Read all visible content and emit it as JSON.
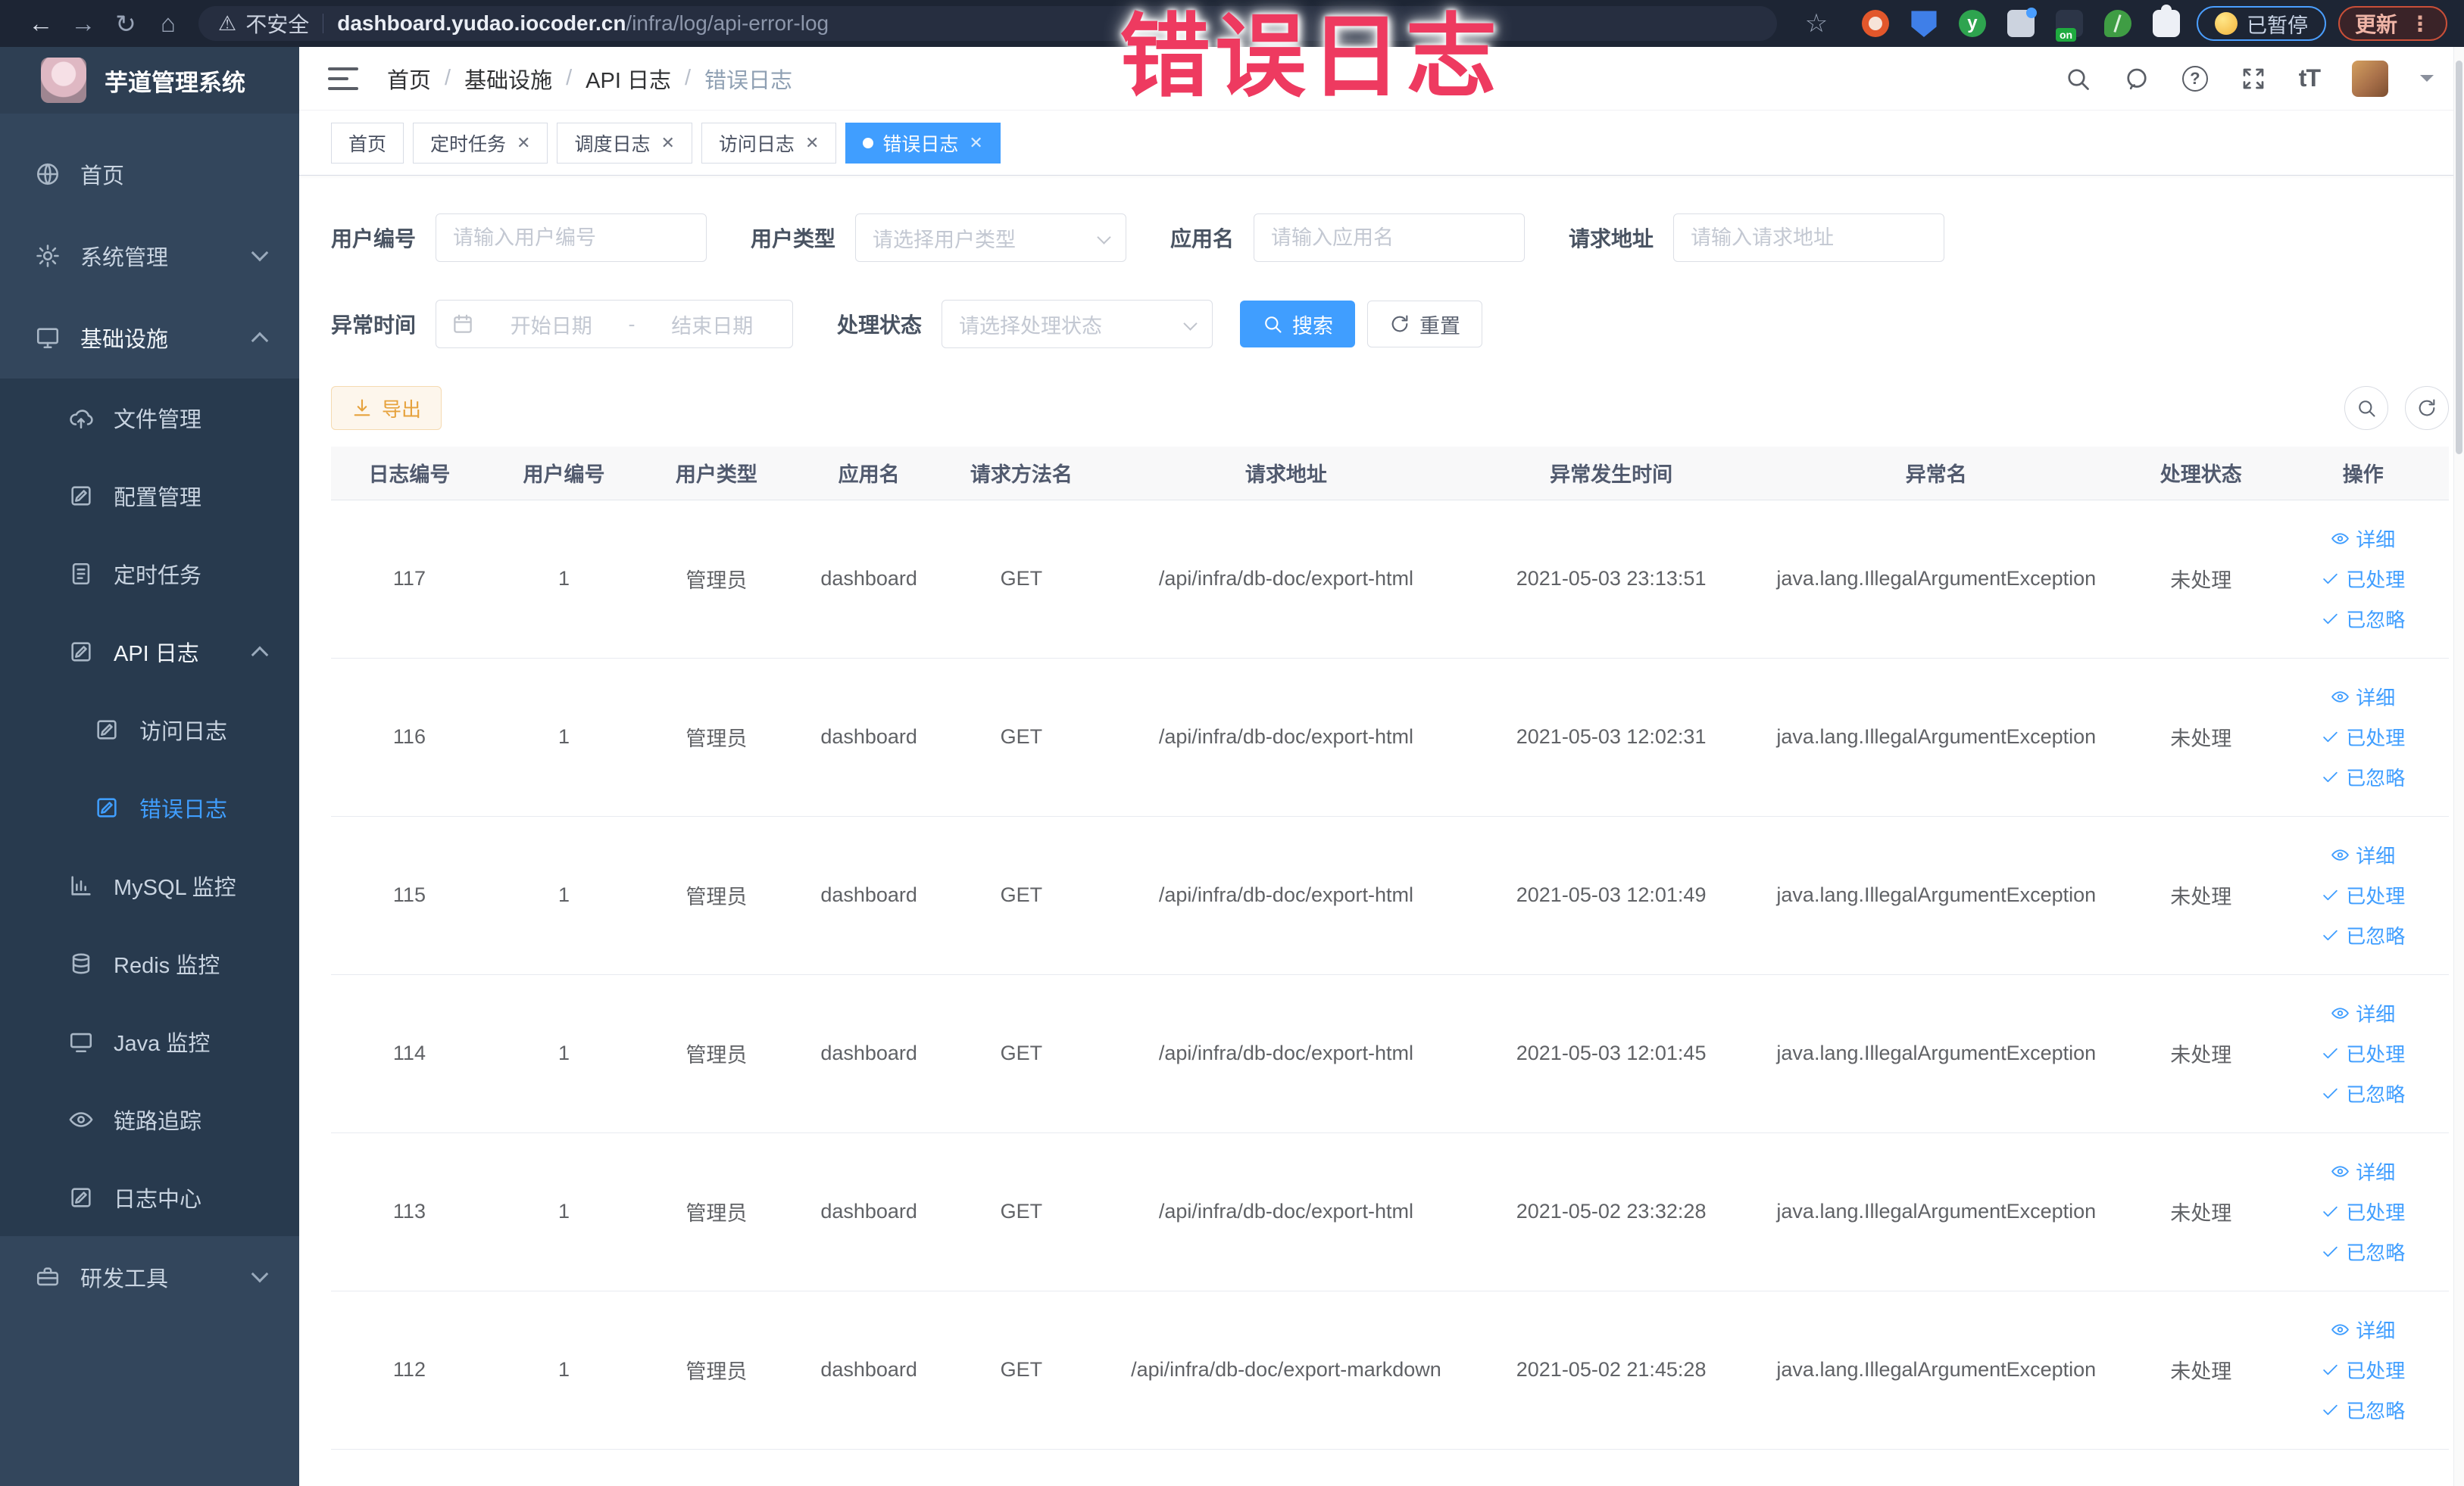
{
  "colors": {
    "accent": "#409eff",
    "warning": "#e6a23c",
    "overlay_red": "#ee3a60",
    "sidebar_bg": "#33465c",
    "sidebar_sub_bg": "#283a4e",
    "browser_bar_bg": "#1d2534",
    "tab_active_bg": "#409eff"
  },
  "browser": {
    "icons": {
      "back": "←",
      "forward": "→",
      "reload": "↻",
      "home": "⌂",
      "star": "☆",
      "warning": "⚠",
      "kebab": "⋮"
    },
    "security_label": "不安全",
    "url_host": "dashboard.yudao.iocoder.cn",
    "url_path": "/infra/log/api-error-log",
    "paused_label": "已暂停",
    "update_label": "更新"
  },
  "overlay": {
    "text": "错误日志"
  },
  "sidebar": {
    "logo_title": "芋道管理系统",
    "items": [
      {
        "key": "home",
        "label": "首页",
        "icon": "globe",
        "level": 1
      },
      {
        "key": "system-management",
        "label": "系统管理",
        "icon": "gear",
        "level": 1,
        "chevron": "down"
      },
      {
        "key": "infrastructure",
        "label": "基础设施",
        "icon": "monitor",
        "level": 1,
        "chevron": "up",
        "bright": true
      },
      {
        "key": "file-management",
        "label": "文件管理",
        "icon": "cloud-up",
        "level": 2,
        "submenu": true
      },
      {
        "key": "config-management",
        "label": "配置管理",
        "icon": "edit",
        "level": 2,
        "submenu": true
      },
      {
        "key": "scheduled-tasks",
        "label": "定时任务",
        "icon": "doc",
        "level": 2,
        "submenu": true
      },
      {
        "key": "api-log",
        "label": "API 日志",
        "icon": "edit",
        "level": 2,
        "chevron": "up",
        "submenu": true,
        "bright": true
      },
      {
        "key": "access-log",
        "label": "访问日志",
        "icon": "edit",
        "level": 3,
        "submenu": true
      },
      {
        "key": "error-log",
        "label": "错误日志",
        "icon": "edit",
        "level": 3,
        "submenu": true,
        "active": true
      },
      {
        "key": "mysql-monitor",
        "label": "MySQL 监控",
        "icon": "chart",
        "level": 2,
        "submenu": true
      },
      {
        "key": "redis-monitor",
        "label": "Redis 监控",
        "icon": "db",
        "level": 2,
        "submenu": true
      },
      {
        "key": "java-monitor",
        "label": "Java 监控",
        "icon": "screen",
        "level": 2,
        "submenu": true
      },
      {
        "key": "trace",
        "label": "链路追踪",
        "icon": "eye",
        "level": 2,
        "submenu": true
      },
      {
        "key": "log-center",
        "label": "日志中心",
        "icon": "edit",
        "level": 2,
        "submenu": true
      },
      {
        "key": "dev-tools",
        "label": "研发工具",
        "icon": "tool",
        "level": 1,
        "chevron": "down"
      }
    ]
  },
  "header": {
    "breadcrumb": [
      "首页",
      "基础设施",
      "API 日志",
      "错误日志"
    ],
    "icons": {
      "font_size": "tT"
    }
  },
  "tabs": [
    {
      "key": "home",
      "label": "首页",
      "closable": false,
      "active": false
    },
    {
      "key": "scheduled-tasks",
      "label": "定时任务",
      "closable": true,
      "active": false
    },
    {
      "key": "schedule-log",
      "label": "调度日志",
      "closable": true,
      "active": false
    },
    {
      "key": "access-log",
      "label": "访问日志",
      "closable": true,
      "active": false
    },
    {
      "key": "error-log",
      "label": "错误日志",
      "closable": true,
      "active": true
    }
  ],
  "filters": {
    "user_id_label": "用户编号",
    "user_id_placeholder": "请输入用户编号",
    "user_type_label": "用户类型",
    "user_type_placeholder": "请选择用户类型",
    "app_label": "应用名",
    "app_placeholder": "请输入应用名",
    "url_label": "请求地址",
    "url_placeholder": "请输入请求地址",
    "time_label": "异常时间",
    "time_start_placeholder": "开始日期",
    "time_separator": "-",
    "time_end_placeholder": "结束日期",
    "status_label": "处理状态",
    "status_placeholder": "请选择处理状态",
    "search_label": "搜索",
    "reset_label": "重置"
  },
  "toolbar": {
    "export_label": "导出"
  },
  "table": {
    "columns": [
      "日志编号",
      "用户编号",
      "用户类型",
      "应用名",
      "请求方法名",
      "请求地址",
      "异常发生时间",
      "异常名",
      "处理状态",
      "操作"
    ],
    "actions": [
      "详细",
      "已处理",
      "已忽略"
    ],
    "rows": [
      {
        "id": "117",
        "user_id": "1",
        "user_type": "管理员",
        "app": "dashboard",
        "method": "GET",
        "url": "/api/infra/db-doc/export-html",
        "time": "2021-05-03 23:13:51",
        "exception": "java.lang.IllegalArgumentException",
        "status": "未处理"
      },
      {
        "id": "116",
        "user_id": "1",
        "user_type": "管理员",
        "app": "dashboard",
        "method": "GET",
        "url": "/api/infra/db-doc/export-html",
        "time": "2021-05-03 12:02:31",
        "exception": "java.lang.IllegalArgumentException",
        "status": "未处理"
      },
      {
        "id": "115",
        "user_id": "1",
        "user_type": "管理员",
        "app": "dashboard",
        "method": "GET",
        "url": "/api/infra/db-doc/export-html",
        "time": "2021-05-03 12:01:49",
        "exception": "java.lang.IllegalArgumentException",
        "status": "未处理"
      },
      {
        "id": "114",
        "user_id": "1",
        "user_type": "管理员",
        "app": "dashboard",
        "method": "GET",
        "url": "/api/infra/db-doc/export-html",
        "time": "2021-05-03 12:01:45",
        "exception": "java.lang.IllegalArgumentException",
        "status": "未处理"
      },
      {
        "id": "113",
        "user_id": "1",
        "user_type": "管理员",
        "app": "dashboard",
        "method": "GET",
        "url": "/api/infra/db-doc/export-html",
        "time": "2021-05-02 23:32:28",
        "exception": "java.lang.IllegalArgumentException",
        "status": "未处理"
      },
      {
        "id": "112",
        "user_id": "1",
        "user_type": "管理员",
        "app": "dashboard",
        "method": "GET",
        "url": "/api/infra/db-doc/export-markdown",
        "time": "2021-05-02 21:45:28",
        "exception": "java.lang.IllegalArgumentException",
        "status": "未处理"
      }
    ]
  }
}
